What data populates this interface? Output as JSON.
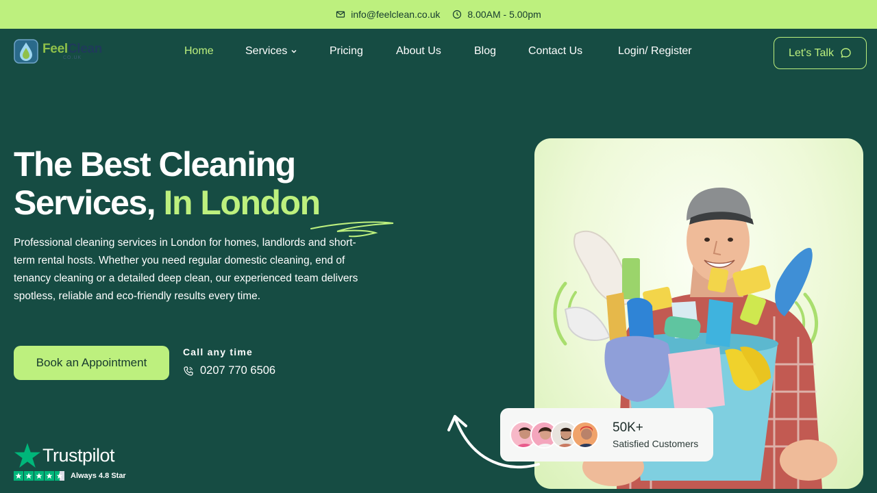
{
  "topbar": {
    "email": "info@feelclean.co.uk",
    "hours": "8.00AM - 5.00pm",
    "email_icon": "mail-icon",
    "hours_icon": "clock-icon"
  },
  "logo": {
    "feel": "Feel",
    "clean": "Clean",
    "suffix": "CO.UK"
  },
  "nav": {
    "items": [
      {
        "label": "Home",
        "active": true
      },
      {
        "label": "Services",
        "has_dropdown": true
      },
      {
        "label": "Pricing"
      },
      {
        "label": "About Us"
      },
      {
        "label": "Blog"
      },
      {
        "label": "Contact Us"
      },
      {
        "label": "Login/ Register"
      }
    ],
    "cta_label": "Let's Talk",
    "cta_icon": "chat-bubble-icon"
  },
  "hero": {
    "title_line1": "The Best Cleaning",
    "title_line2": "Services,",
    "title_accent": "In London",
    "description": "Professional cleaning services in London for homes, landlords and short-term rental hosts. Whether you need regular domestic cleaning, end of tenancy cleaning or a detailed deep clean, our experienced team delivers spotless, reliable and eco-friendly results every time.",
    "book_label": "Book an Appointment",
    "call_label": "Call any time",
    "phone": "0207 770 6506",
    "phone_icon": "phone-icon"
  },
  "trustpilot": {
    "name": "Trustpilot",
    "rating_text": "Always 4.8 Star",
    "stars": 4.5
  },
  "customers": {
    "count": "50K+",
    "label": "Satisfied Customers"
  },
  "colors": {
    "background": "#164c43",
    "accent": "#bdf07e",
    "topbar": "#bdf07e",
    "trustpilot_green": "#00b67a"
  }
}
